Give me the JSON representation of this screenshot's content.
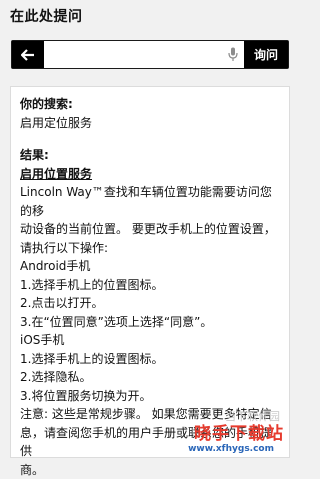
{
  "header": {
    "title": "在此处提问"
  },
  "search": {
    "placeholder": "",
    "value": "",
    "submit_label": "询问"
  },
  "result": {
    "query_label": "你的搜索:",
    "query_text": "启用定位服务",
    "result_label": "结果:",
    "result_title": "启用位置服务",
    "lines": [
      "Lincoln Way™查找和车辆位置功能需要访问您的移",
      "动设备的当前位置。 要更改手机上的位置设置，",
      "请执行以下操作:",
      "Android手机",
      "1.选择手机上的位置图标。",
      "2.点击以打开。",
      "3.在“位置同意”选项上选择“同意”。",
      "iOS手机",
      "1.选择手机上的设置图标。",
      "2.选择隐私。",
      "3.将位置服务切换为开。",
      "注意: 这些是常规步骤。 如果您需要更多特定信",
      "息，请查阅您手机的用户手册或联系您的手机提供",
      "商。"
    ]
  },
  "watermark": {
    "line1": "当下软件园",
    "line2": "晓手下载站",
    "line3": "www.xfhygs.com"
  }
}
